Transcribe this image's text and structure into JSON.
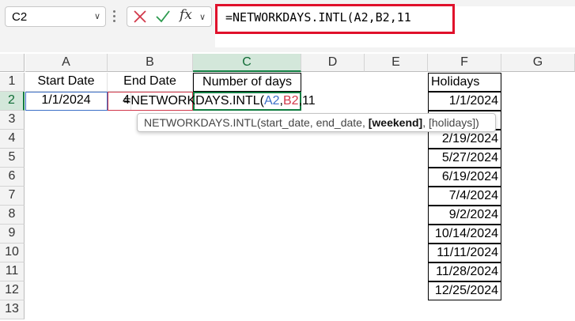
{
  "formula_bar": {
    "name_box": "C2",
    "fx_label": "fx",
    "formula": "=NETWORKDAYS.INTL(A2,B2,11"
  },
  "columns": [
    "A",
    "B",
    "C",
    "D",
    "E",
    "F",
    "G"
  ],
  "rows": [
    "1",
    "2",
    "3",
    "4",
    "5",
    "6",
    "7",
    "8",
    "9",
    "10",
    "11",
    "12",
    "13"
  ],
  "headers": {
    "a1": "Start Date",
    "b1": "End Date",
    "c1": "Number of days",
    "f1": "Holidays"
  },
  "cells": {
    "a2": "1/1/2024",
    "b2_visible": "4"
  },
  "editing": {
    "fn": "=NETWORKDAYS.INTL(",
    "ref_a": "A2",
    "comma1": ",",
    "ref_b": "B2",
    "rest": ",11"
  },
  "tooltip": {
    "fn": "NETWORKDAYS.INTL(start_date, end_date, ",
    "current_arg": "[weekend]",
    "tail": ", [holidays])"
  },
  "holidays": [
    "1/1/2024",
    "",
    "2/19/2024",
    "5/27/2024",
    "6/19/2024",
    "7/4/2024",
    "9/2/2024",
    "10/14/2024",
    "11/11/2024",
    "11/28/2024",
    "12/25/2024"
  ],
  "colors": {
    "accent": "#107c41",
    "highlight_box": "#e0102b",
    "ref_a": "#3c6fc7",
    "ref_b": "#d1374a"
  }
}
